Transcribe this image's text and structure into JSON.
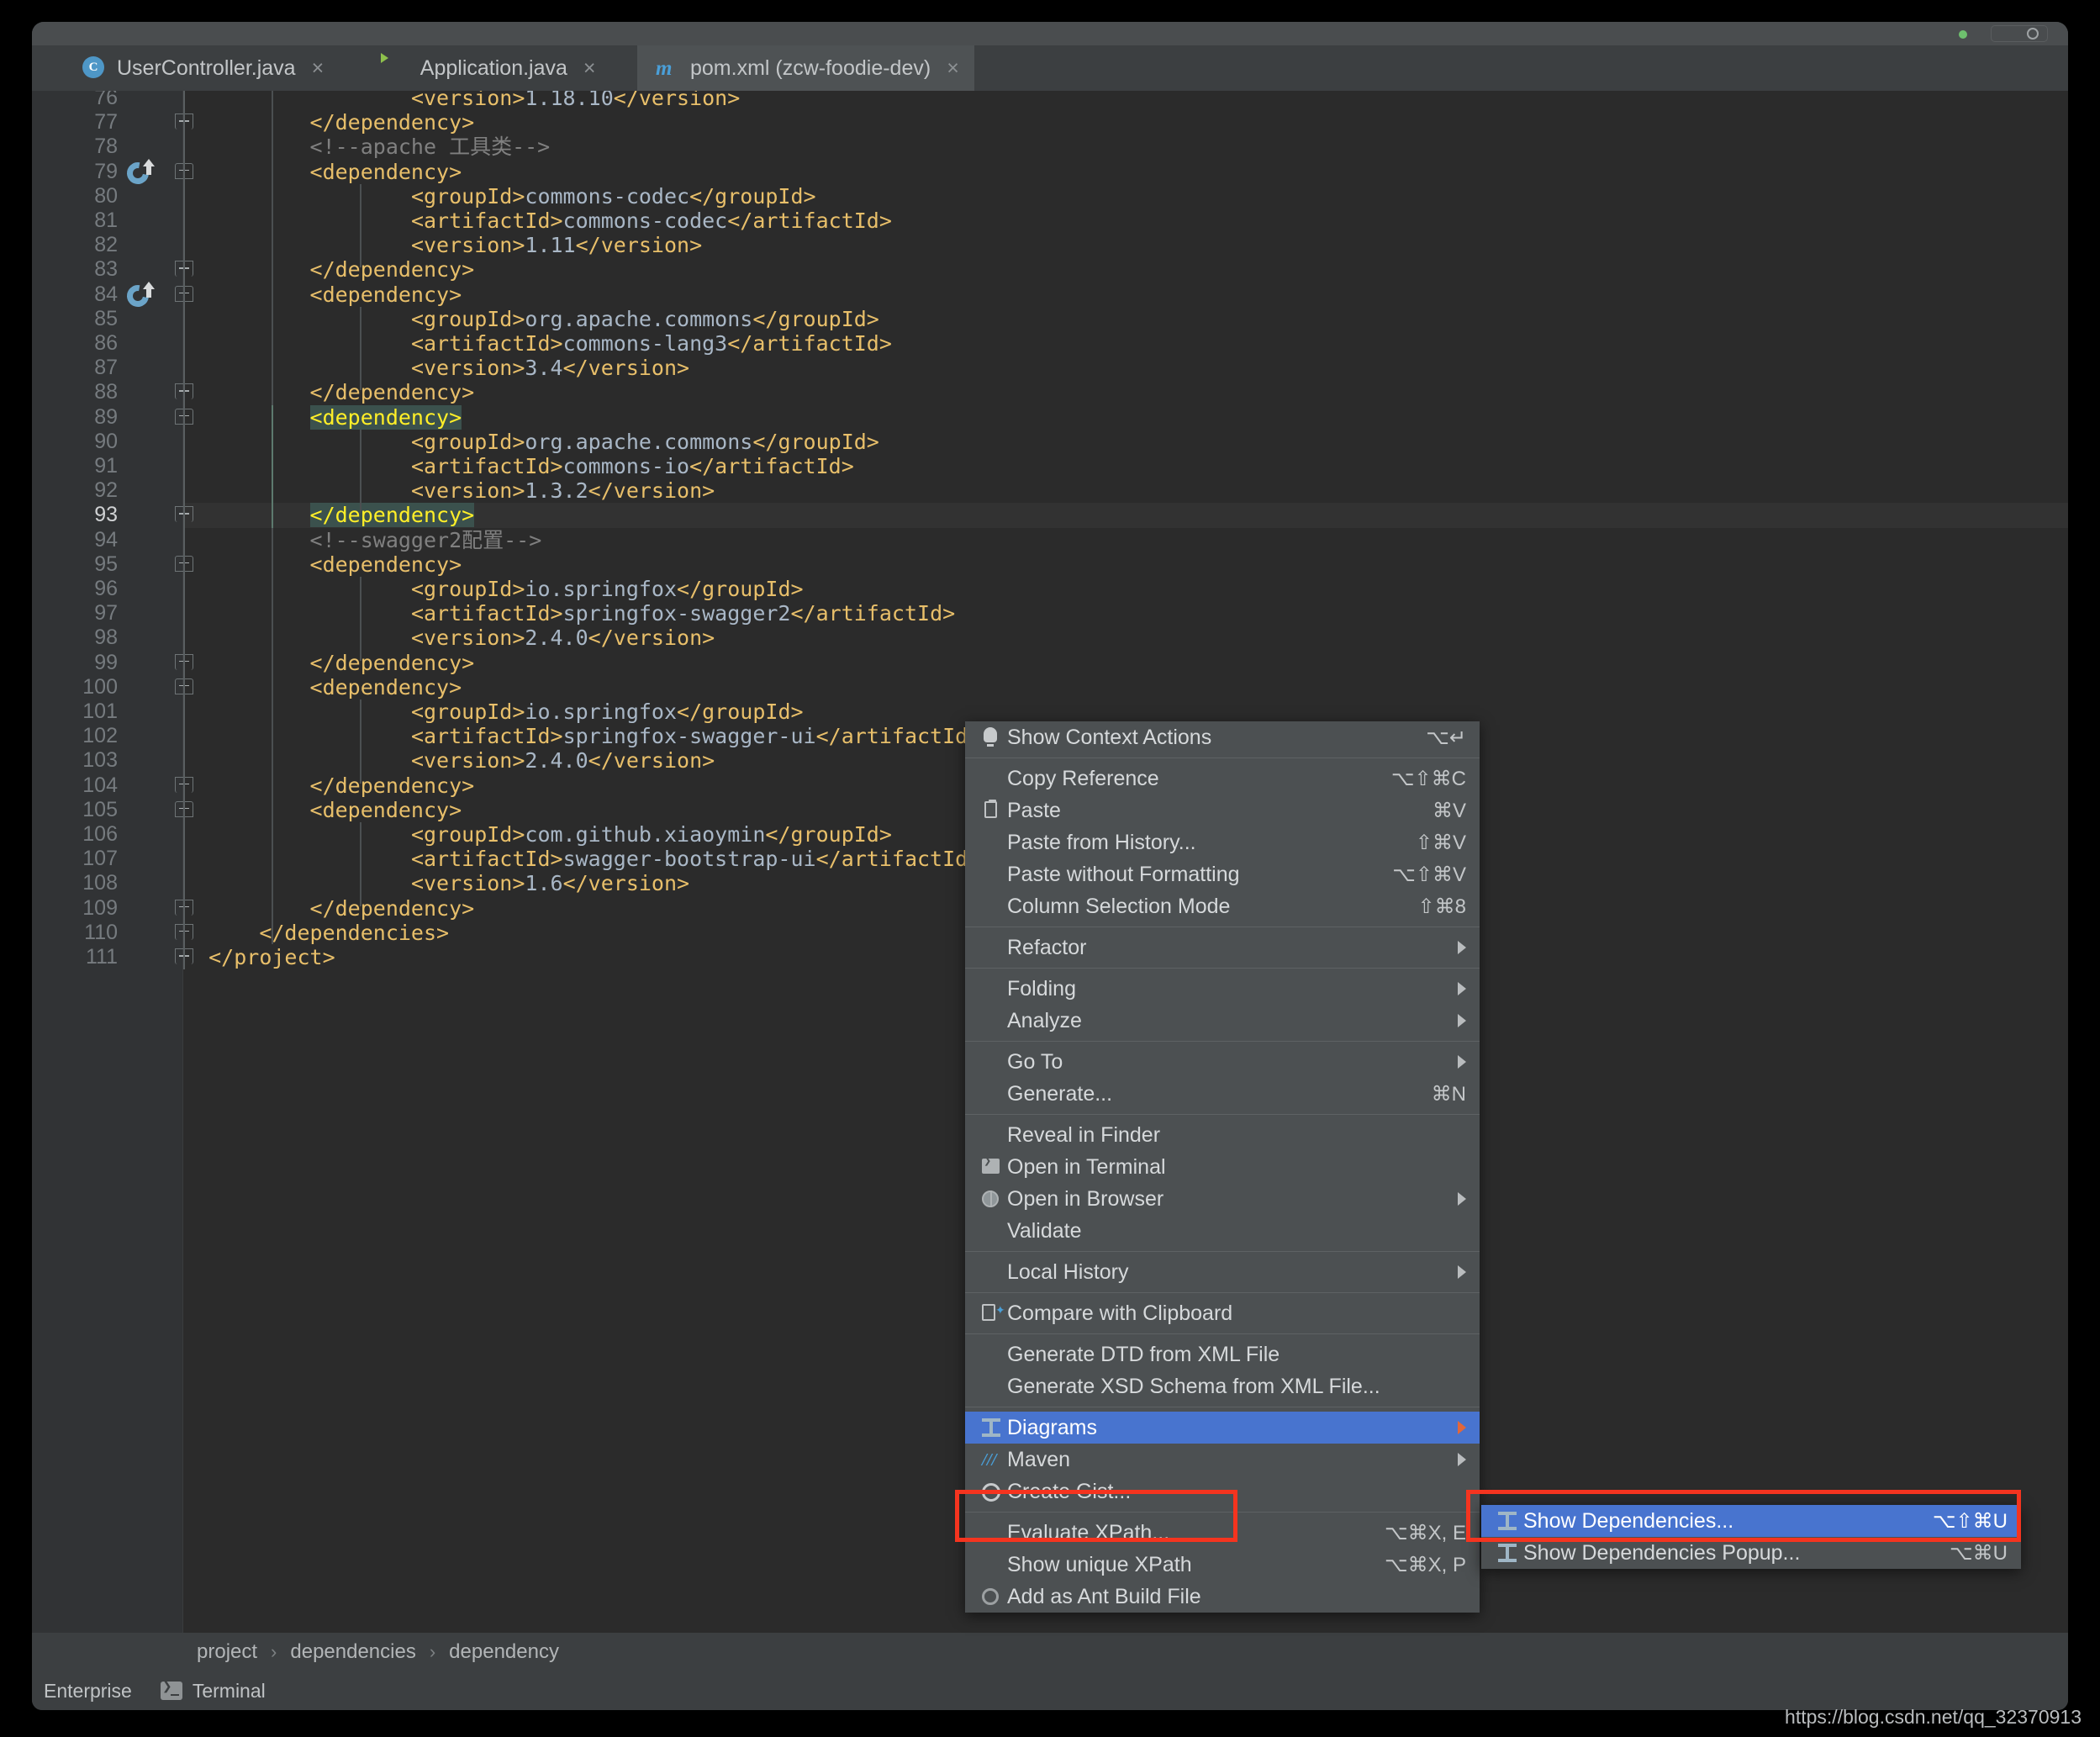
{
  "window": {
    "title_green_dot": "run-indicator",
    "settings_button": "settings-button"
  },
  "tabs": [
    {
      "label": "UserController.java",
      "icon": "java-class-icon",
      "close": "×",
      "active": false
    },
    {
      "label": "Application.java",
      "icon": "spring-boot-class-icon",
      "close": "×",
      "active": false
    },
    {
      "label": "pom.xml (zcw-foodie-dev)",
      "icon": "maven-file-icon",
      "close": "×",
      "active": true
    }
  ],
  "editor": {
    "first_line_number": 76,
    "lines": [
      {
        "n": 76,
        "indent": 8,
        "tokens": [
          [
            "tag",
            "<version>"
          ],
          [
            "txt",
            "1.18.10"
          ],
          [
            "tag",
            "</version>"
          ]
        ]
      },
      {
        "n": 77,
        "indent": 4,
        "fold": "bot",
        "tokens": [
          [
            "tag",
            "</dependency>"
          ]
        ]
      },
      {
        "n": 78,
        "indent": 4,
        "tokens": [
          [
            "cmt",
            "<!--apache 工具类-->"
          ]
        ]
      },
      {
        "n": 79,
        "indent": 4,
        "fold": "top",
        "maven": true,
        "tokens": [
          [
            "tag",
            "<dependency>"
          ]
        ]
      },
      {
        "n": 80,
        "indent": 8,
        "tokens": [
          [
            "tag",
            "<groupId>"
          ],
          [
            "txt",
            "commons-codec"
          ],
          [
            "tag",
            "</groupId>"
          ]
        ]
      },
      {
        "n": 81,
        "indent": 8,
        "tokens": [
          [
            "tag",
            "<artifactId>"
          ],
          [
            "txt",
            "commons-codec"
          ],
          [
            "tag",
            "</artifactId>"
          ]
        ]
      },
      {
        "n": 82,
        "indent": 8,
        "tokens": [
          [
            "tag",
            "<version>"
          ],
          [
            "txt",
            "1.11"
          ],
          [
            "tag",
            "</version>"
          ]
        ]
      },
      {
        "n": 83,
        "indent": 4,
        "fold": "bot",
        "tokens": [
          [
            "tag",
            "</dependency>"
          ]
        ]
      },
      {
        "n": 84,
        "indent": 4,
        "fold": "top",
        "maven": true,
        "tokens": [
          [
            "tag",
            "<dependency>"
          ]
        ]
      },
      {
        "n": 85,
        "indent": 8,
        "tokens": [
          [
            "tag",
            "<groupId>"
          ],
          [
            "txt",
            "org.apache.commons"
          ],
          [
            "tag",
            "</groupId>"
          ]
        ]
      },
      {
        "n": 86,
        "indent": 8,
        "tokens": [
          [
            "tag",
            "<artifactId>"
          ],
          [
            "txt",
            "commons-lang3"
          ],
          [
            "tag",
            "</artifactId>"
          ]
        ]
      },
      {
        "n": 87,
        "indent": 8,
        "tokens": [
          [
            "tag",
            "<version>"
          ],
          [
            "txt",
            "3.4"
          ],
          [
            "tag",
            "</version>"
          ]
        ]
      },
      {
        "n": 88,
        "indent": 4,
        "fold": "bot",
        "tokens": [
          [
            "tag",
            "</dependency>"
          ]
        ]
      },
      {
        "n": 89,
        "indent": 4,
        "fold": "top",
        "brace": true,
        "tokens": [
          [
            "tag",
            "<dependency>"
          ]
        ]
      },
      {
        "n": 90,
        "indent": 8,
        "tokens": [
          [
            "tag",
            "<groupId>"
          ],
          [
            "txt",
            "org.apache.commons"
          ],
          [
            "tag",
            "</groupId>"
          ]
        ]
      },
      {
        "n": 91,
        "indent": 8,
        "tokens": [
          [
            "tag",
            "<artifactId>"
          ],
          [
            "txt",
            "commons-io"
          ],
          [
            "tag",
            "</artifactId>"
          ]
        ]
      },
      {
        "n": 92,
        "indent": 8,
        "tokens": [
          [
            "tag",
            "<version>"
          ],
          [
            "txt",
            "1.3.2"
          ],
          [
            "tag",
            "</version>"
          ]
        ]
      },
      {
        "n": 93,
        "indent": 4,
        "fold": "bot",
        "brace": true,
        "current": true,
        "tokens": [
          [
            "tag",
            "</dependency>"
          ]
        ]
      },
      {
        "n": 94,
        "indent": 4,
        "tokens": [
          [
            "cmt",
            "<!--swagger2配置-->"
          ]
        ]
      },
      {
        "n": 95,
        "indent": 4,
        "fold": "top",
        "tokens": [
          [
            "tag",
            "<dependency>"
          ]
        ]
      },
      {
        "n": 96,
        "indent": 8,
        "tokens": [
          [
            "tag",
            "<groupId>"
          ],
          [
            "txt",
            "io.springfox"
          ],
          [
            "tag",
            "</groupId>"
          ]
        ]
      },
      {
        "n": 97,
        "indent": 8,
        "tokens": [
          [
            "tag",
            "<artifactId>"
          ],
          [
            "txt",
            "springfox-swagger2"
          ],
          [
            "tag",
            "</artifactId>"
          ]
        ]
      },
      {
        "n": 98,
        "indent": 8,
        "tokens": [
          [
            "tag",
            "<version>"
          ],
          [
            "txt",
            "2.4.0"
          ],
          [
            "tag",
            "</version>"
          ]
        ]
      },
      {
        "n": 99,
        "indent": 4,
        "fold": "bot",
        "tokens": [
          [
            "tag",
            "</dependency>"
          ]
        ]
      },
      {
        "n": 100,
        "indent": 4,
        "fold": "top",
        "tokens": [
          [
            "tag",
            "<dependency>"
          ]
        ]
      },
      {
        "n": 101,
        "indent": 8,
        "tokens": [
          [
            "tag",
            "<groupId>"
          ],
          [
            "txt",
            "io.springfox"
          ],
          [
            "tag",
            "</groupId>"
          ]
        ]
      },
      {
        "n": 102,
        "indent": 8,
        "tokens": [
          [
            "tag",
            "<artifactId>"
          ],
          [
            "txt",
            "springfox-swagger-ui"
          ],
          [
            "tag",
            "</artifactId>"
          ]
        ]
      },
      {
        "n": 103,
        "indent": 8,
        "tokens": [
          [
            "tag",
            "<version>"
          ],
          [
            "txt",
            "2.4.0"
          ],
          [
            "tag",
            "</version>"
          ]
        ]
      },
      {
        "n": 104,
        "indent": 4,
        "fold": "bot",
        "tokens": [
          [
            "tag",
            "</dependency>"
          ]
        ]
      },
      {
        "n": 105,
        "indent": 4,
        "fold": "top",
        "tokens": [
          [
            "tag",
            "<dependency>"
          ]
        ]
      },
      {
        "n": 106,
        "indent": 8,
        "tokens": [
          [
            "tag",
            "<groupId>"
          ],
          [
            "txt",
            "com.github.xiaoymin"
          ],
          [
            "tag",
            "</groupId>"
          ]
        ]
      },
      {
        "n": 107,
        "indent": 8,
        "tokens": [
          [
            "tag",
            "<artifactId>"
          ],
          [
            "txt",
            "swagger-bootstrap-ui"
          ],
          [
            "tag",
            "</artifactId>"
          ]
        ]
      },
      {
        "n": 108,
        "indent": 8,
        "tokens": [
          [
            "tag",
            "<version>"
          ],
          [
            "txt",
            "1.6"
          ],
          [
            "tag",
            "</version>"
          ]
        ]
      },
      {
        "n": 109,
        "indent": 4,
        "fold": "bot",
        "tokens": [
          [
            "tag",
            "</dependency>"
          ]
        ]
      },
      {
        "n": 110,
        "indent": 2,
        "fold": "bot",
        "tokens": [
          [
            "tag",
            "</dependencies>"
          ]
        ]
      },
      {
        "n": 111,
        "indent": 0,
        "fold": "bot",
        "tokens": [
          [
            "tag",
            "</project>"
          ]
        ]
      }
    ]
  },
  "breadcrumb": {
    "items": [
      "project",
      "dependencies",
      "dependency"
    ],
    "separator": "›"
  },
  "statusbar": {
    "items": [
      "Enterprise",
      "Terminal"
    ],
    "terminal_icon": "terminal-icon"
  },
  "context_menu": {
    "groups": [
      {
        "items": [
          {
            "label": "Show Context Actions",
            "shortcut": "⌥↵",
            "icon": "lightbulb-icon",
            "arrow": false,
            "selected": false
          }
        ]
      },
      {
        "items": [
          {
            "label": "Copy Reference",
            "shortcut": "⌥⇧⌘C",
            "icon": "",
            "arrow": false,
            "selected": false
          },
          {
            "label": "Paste",
            "shortcut": "⌘V",
            "icon": "clipboard-icon",
            "arrow": false,
            "selected": false
          },
          {
            "label": "Paste from History...",
            "shortcut": "⇧⌘V",
            "icon": "",
            "arrow": false,
            "selected": false
          },
          {
            "label": "Paste without Formatting",
            "shortcut": "⌥⇧⌘V",
            "icon": "",
            "arrow": false,
            "selected": false
          },
          {
            "label": "Column Selection Mode",
            "shortcut": "⇧⌘8",
            "icon": "",
            "arrow": false,
            "selected": false
          }
        ]
      },
      {
        "items": [
          {
            "label": "Refactor",
            "shortcut": "",
            "icon": "",
            "arrow": true,
            "selected": false
          }
        ]
      },
      {
        "items": [
          {
            "label": "Folding",
            "shortcut": "",
            "icon": "",
            "arrow": true,
            "selected": false
          },
          {
            "label": "Analyze",
            "shortcut": "",
            "icon": "",
            "arrow": true,
            "selected": false
          }
        ]
      },
      {
        "items": [
          {
            "label": "Go To",
            "shortcut": "",
            "icon": "",
            "arrow": true,
            "selected": false
          },
          {
            "label": "Generate...",
            "shortcut": "⌘N",
            "icon": "",
            "arrow": false,
            "selected": false
          }
        ]
      },
      {
        "items": [
          {
            "label": "Reveal in Finder",
            "shortcut": "",
            "icon": "",
            "arrow": false,
            "selected": false
          },
          {
            "label": "Open in Terminal",
            "shortcut": "",
            "icon": "terminal-icon",
            "arrow": false,
            "selected": false
          },
          {
            "label": "Open in Browser",
            "shortcut": "",
            "icon": "globe-icon",
            "arrow": true,
            "selected": false
          },
          {
            "label": "Validate",
            "shortcut": "",
            "icon": "",
            "arrow": false,
            "selected": false
          }
        ]
      },
      {
        "items": [
          {
            "label": "Local History",
            "shortcut": "",
            "icon": "",
            "arrow": true,
            "selected": false
          }
        ]
      },
      {
        "items": [
          {
            "label": "Compare with Clipboard",
            "shortcut": "",
            "icon": "compare-icon",
            "arrow": false,
            "selected": false
          }
        ]
      },
      {
        "items": [
          {
            "label": "Generate DTD from XML File",
            "shortcut": "",
            "icon": "",
            "arrow": false,
            "selected": false
          },
          {
            "label": "Generate XSD Schema from XML File...",
            "shortcut": "",
            "icon": "",
            "arrow": false,
            "selected": false
          }
        ]
      },
      {
        "items": [
          {
            "label": "Diagrams",
            "shortcut": "",
            "icon": "diagram-icon",
            "arrow": true,
            "selected": true
          },
          {
            "label": "Maven",
            "shortcut": "",
            "icon": "maven-icon",
            "arrow": true,
            "selected": false
          },
          {
            "label": "Create Gist...",
            "shortcut": "",
            "icon": "github-icon",
            "arrow": false,
            "selected": false
          }
        ]
      },
      {
        "items": [
          {
            "label": "Evaluate XPath...",
            "shortcut": "⌥⌘X, E",
            "icon": "",
            "arrow": false,
            "selected": false
          },
          {
            "label": "Show unique XPath",
            "shortcut": "⌥⌘X, P",
            "icon": "",
            "arrow": false,
            "selected": false
          },
          {
            "label": "Add as Ant Build File",
            "shortcut": "",
            "icon": "build-icon",
            "arrow": false,
            "selected": false
          }
        ]
      }
    ]
  },
  "submenu": {
    "items": [
      {
        "label": "Show Dependencies...",
        "shortcut": "⌥⇧⌘U",
        "icon": "diagram-icon",
        "selected": true
      },
      {
        "label": "Show Dependencies Popup...",
        "shortcut": "⌥⌘U",
        "icon": "diagram-icon",
        "selected": false
      }
    ]
  },
  "annotations": {
    "highlight_color": "#f5341f",
    "selection_color": "#4874cf"
  },
  "watermark": {
    "text": "https://blog.csdn.net/qq_32370913"
  }
}
